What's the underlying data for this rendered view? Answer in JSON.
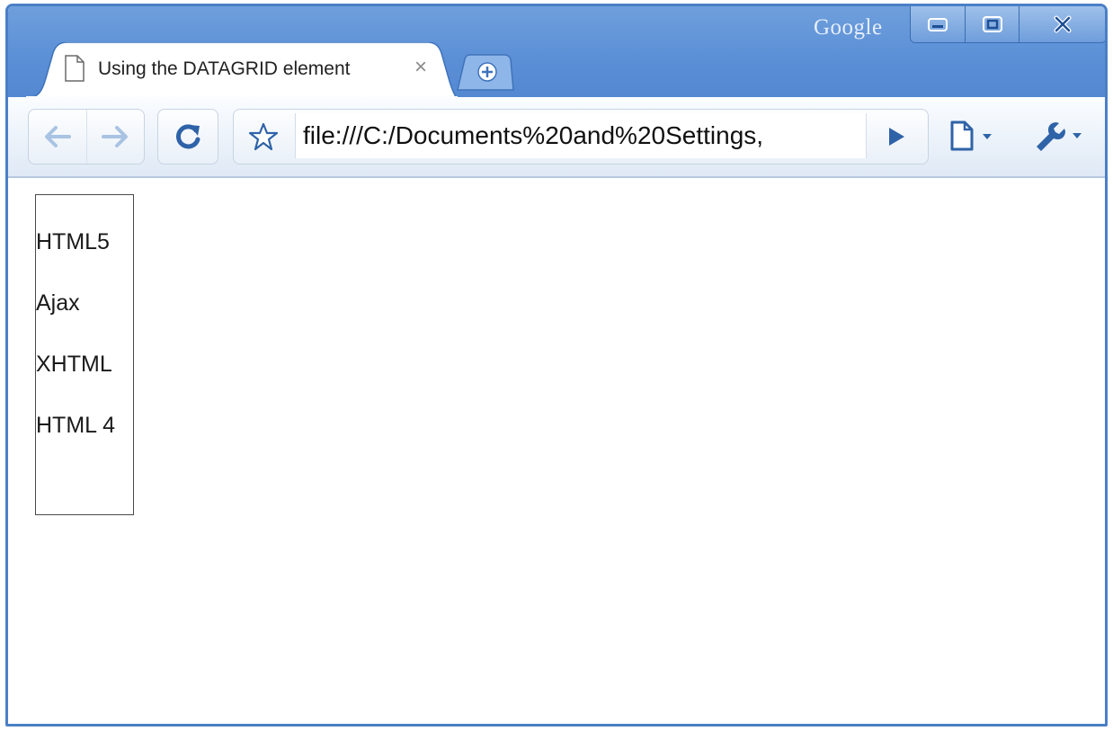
{
  "window": {
    "brand": "Google",
    "controls": [
      "minimize",
      "restore",
      "close"
    ]
  },
  "tab": {
    "title": "Using the DATAGRID element",
    "close_glyph": "×",
    "icon": "document-icon"
  },
  "toolbar": {
    "back_icon": "back-arrow-icon",
    "forward_icon": "forward-arrow-icon",
    "reload_icon": "reload-icon",
    "bookmark_icon": "star-icon",
    "url": "file:///C:/Documents%20and%20Settings,",
    "go_icon": "play-icon",
    "page_menu_icon": "page-icon",
    "tools_menu_icon": "wrench-icon"
  },
  "datagrid": {
    "items": [
      "HTML5",
      "Ajax",
      "XHTML",
      "HTML 4"
    ]
  },
  "colors": {
    "frame": "#4a7fc6",
    "titlebar": "#5a8fd6",
    "toolbar": "#eef4fb",
    "icon_blue": "#2f63a8"
  }
}
